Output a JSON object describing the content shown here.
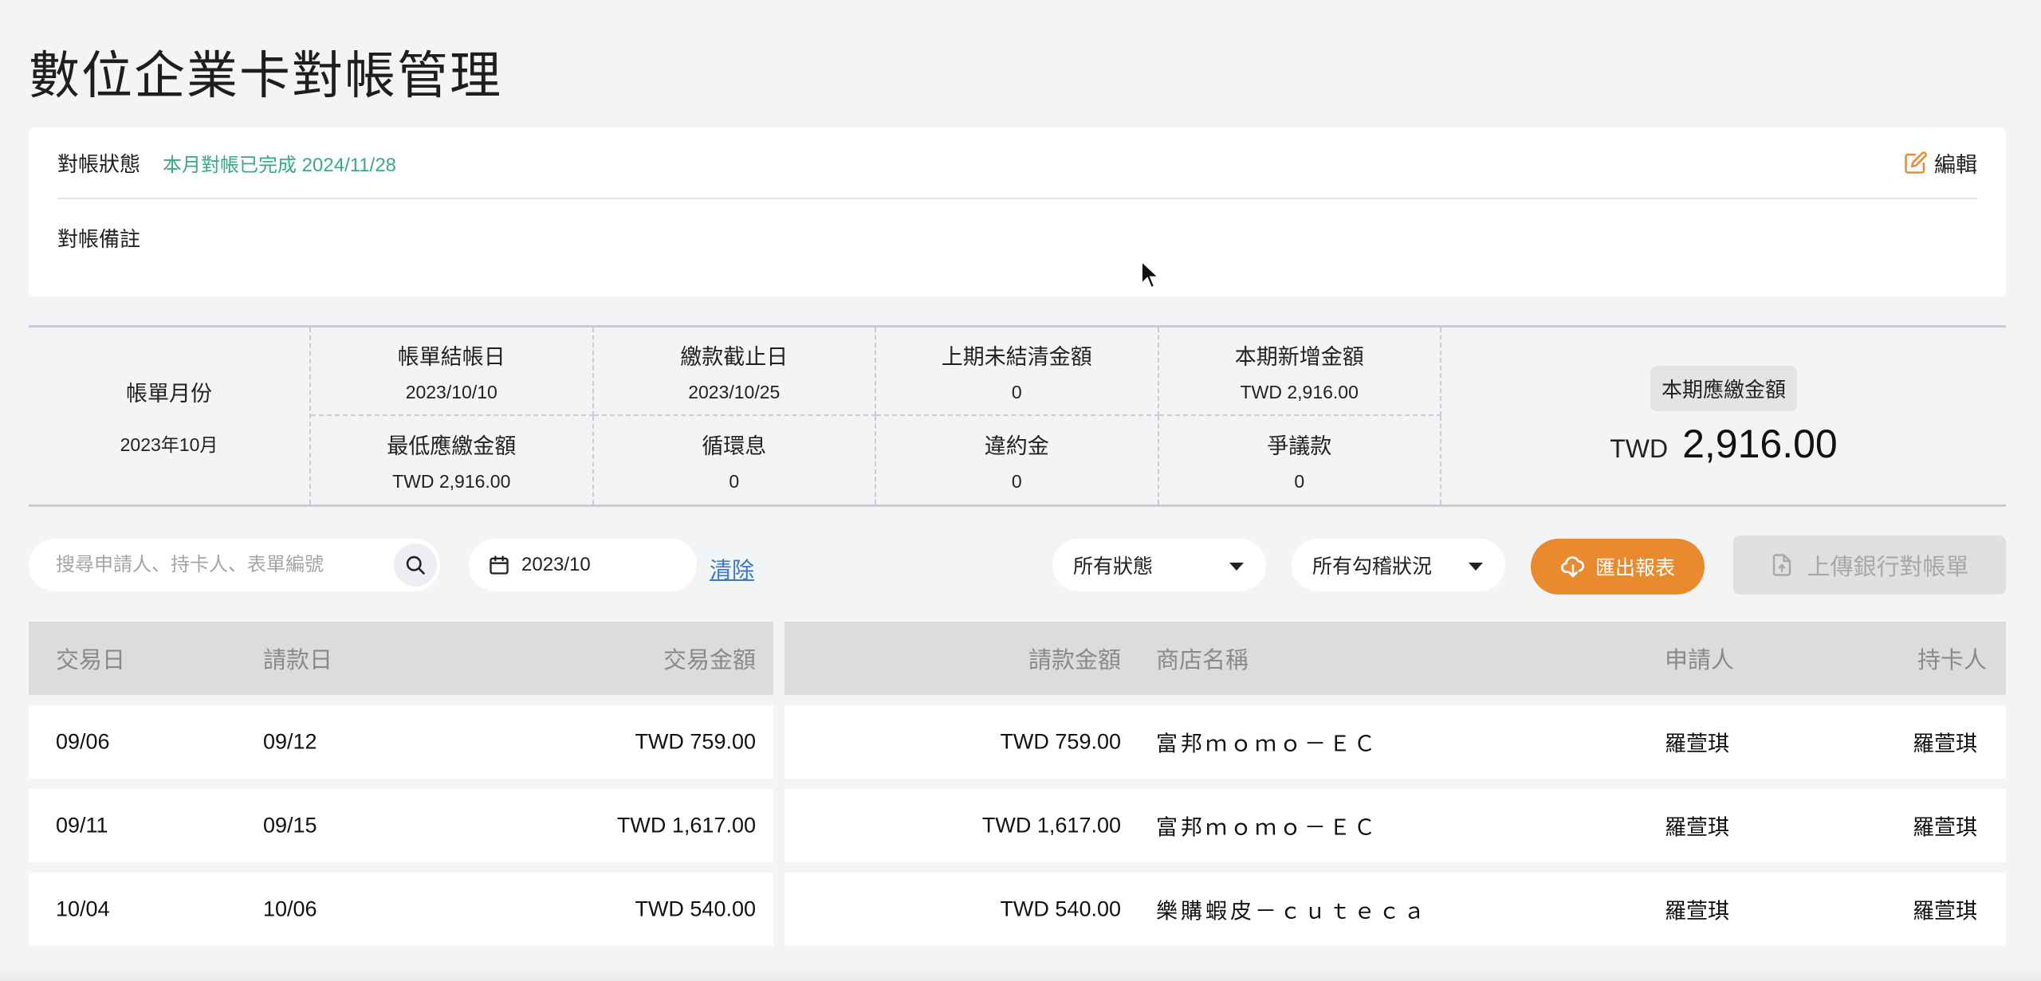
{
  "page": {
    "title": "數位企業卡對帳管理"
  },
  "status": {
    "label": "對帳狀態",
    "value": "本月對帳已完成 2024/11/28",
    "edit_label": "編輯",
    "note_label": "對帳備註"
  },
  "summary": {
    "month_label": "帳單月份",
    "month_value": "2023年10月",
    "cells": [
      {
        "label": "帳單結帳日",
        "value": "2023/10/10"
      },
      {
        "label": "繳款截止日",
        "value": "2023/10/25"
      },
      {
        "label": "上期未結清金額",
        "value": "0"
      },
      {
        "label": "本期新增金額",
        "value": "TWD 2,916.00"
      },
      {
        "label": "最低應繳金額",
        "value": "TWD 2,916.00"
      },
      {
        "label": "循環息",
        "value": "0"
      },
      {
        "label": "違約金",
        "value": "0"
      },
      {
        "label": "爭議款",
        "value": "0"
      }
    ],
    "total_label": "本期應繳金額",
    "total_currency": "TWD",
    "total_value": "2,916.00"
  },
  "toolbar": {
    "search_placeholder": "搜尋申請人、持卡人、表單編號",
    "date_value": "2023/10",
    "clear_label": "清除",
    "status_select": "所有狀態",
    "check_select": "所有勾稽狀況",
    "export_label": "匯出報表",
    "upload_label": "上傳銀行對帳單"
  },
  "table": {
    "headers": {
      "trade_date": "交易日",
      "claim_date": "請款日",
      "trade_amount": "交易金額",
      "claim_amount": "請款金額",
      "shop": "商店名稱",
      "applicant": "申請人",
      "cardholder": "持卡人"
    },
    "rows": [
      {
        "trade_date": "09/06",
        "claim_date": "09/12",
        "trade_amount": "TWD 759.00",
        "claim_amount": "TWD 759.00",
        "shop": "富邦ｍｏｍｏ－ＥＣ",
        "applicant": "羅萱琪",
        "cardholder": "羅萱琪"
      },
      {
        "trade_date": "09/11",
        "claim_date": "09/15",
        "trade_amount": "TWD 1,617.00",
        "claim_amount": "TWD 1,617.00",
        "shop": "富邦ｍｏｍｏ－ＥＣ",
        "applicant": "羅萱琪",
        "cardholder": "羅萱琪"
      },
      {
        "trade_date": "10/04",
        "claim_date": "10/06",
        "trade_amount": "TWD 540.00",
        "claim_amount": "TWD 540.00",
        "shop": "樂購蝦皮－ｃｕｔｅｃａ",
        "applicant": "羅萱琪",
        "cardholder": "羅萱琪"
      }
    ]
  },
  "colors": {
    "accent_green": "#3aa88a",
    "export_orange": "#ea8a2e",
    "link_blue": "#3a78c9"
  }
}
